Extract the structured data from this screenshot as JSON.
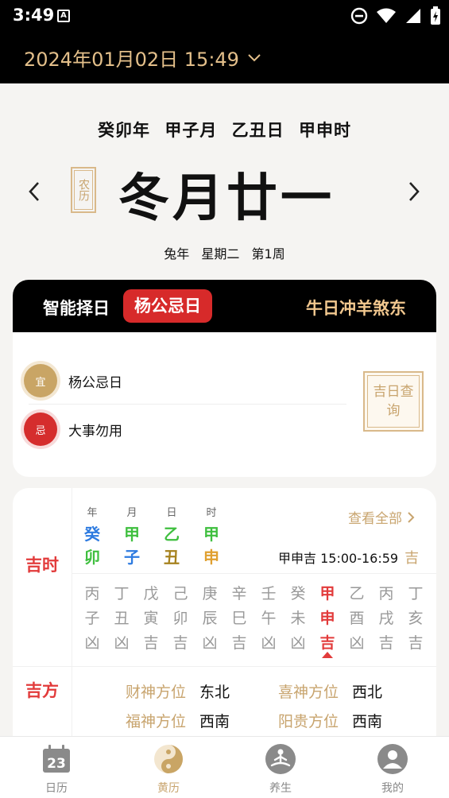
{
  "status_bar": {
    "time": "3:49",
    "notification": "A"
  },
  "header": {
    "date_text": "2024年01月02日 15:49"
  },
  "ganzhi": {
    "year": "癸卯年",
    "month": "甲子月",
    "day": "乙丑日",
    "hour": "甲申时"
  },
  "lunar": {
    "seal": "农历",
    "date": "冬月廿一",
    "zodiac_year": "兔年",
    "weekday": "星期二",
    "week_no": "第1周"
  },
  "card_yiji": {
    "title": "智能择日",
    "badge": "杨公忌日",
    "chong_sha": "牛日冲羊煞东",
    "yi": {
      "icon_label": "宜",
      "text": "杨公忌日"
    },
    "ji": {
      "icon_label": "忌",
      "text": "大事勿用"
    },
    "jiri_button": "吉日查询"
  },
  "card_jishi": {
    "label_jishi": "吉时",
    "label_jifang": "吉方",
    "columns": [
      {
        "label": "年",
        "gan": "癸",
        "zhi": "卯",
        "gan_color": "#2e7be0",
        "zhi_color": "#3fbf3f"
      },
      {
        "label": "月",
        "gan": "甲",
        "zhi": "子",
        "gan_color": "#3fbf3f",
        "zhi_color": "#2e7be0"
      },
      {
        "label": "日",
        "gan": "乙",
        "zhi": "丑",
        "gan_color": "#3fbf3f",
        "zhi_color": "#a6821e"
      },
      {
        "label": "时",
        "gan": "甲",
        "zhi": "申",
        "gan_color": "#3fbf3f",
        "zhi_color": "#e0a030"
      }
    ],
    "view_all": "查看全部",
    "current_shichen": "甲申吉 15:00-16:59",
    "current_ji": "吉",
    "hours": [
      {
        "gan": "丙",
        "zhi": "子",
        "luck": "凶"
      },
      {
        "gan": "丁",
        "zhi": "丑",
        "luck": "凶"
      },
      {
        "gan": "戊",
        "zhi": "寅",
        "luck": "吉"
      },
      {
        "gan": "己",
        "zhi": "卯",
        "luck": "吉"
      },
      {
        "gan": "庚",
        "zhi": "辰",
        "luck": "凶"
      },
      {
        "gan": "辛",
        "zhi": "巳",
        "luck": "吉"
      },
      {
        "gan": "壬",
        "zhi": "午",
        "luck": "凶"
      },
      {
        "gan": "癸",
        "zhi": "未",
        "luck": "凶"
      },
      {
        "gan": "甲",
        "zhi": "申",
        "luck": "吉",
        "active": true
      },
      {
        "gan": "乙",
        "zhi": "酉",
        "luck": "凶"
      },
      {
        "gan": "丙",
        "zhi": "戌",
        "luck": "吉"
      },
      {
        "gan": "丁",
        "zhi": "亥",
        "luck": "吉"
      }
    ],
    "directions": {
      "caishen": {
        "label": "财神方位",
        "value": "东北"
      },
      "xishen": {
        "label": "喜神方位",
        "value": "西北"
      },
      "fushen": {
        "label": "福神方位",
        "value": "西南"
      },
      "yanggui": {
        "label": "阳贵方位",
        "value": "西南"
      }
    }
  },
  "tabbar": [
    {
      "label": "日历",
      "icon": "calendar-icon",
      "badge": "23"
    },
    {
      "label": "黄历",
      "icon": "yin-yang-icon",
      "active": true
    },
    {
      "label": "养生",
      "icon": "meditation-icon"
    },
    {
      "label": "我的",
      "icon": "user-icon"
    }
  ]
}
